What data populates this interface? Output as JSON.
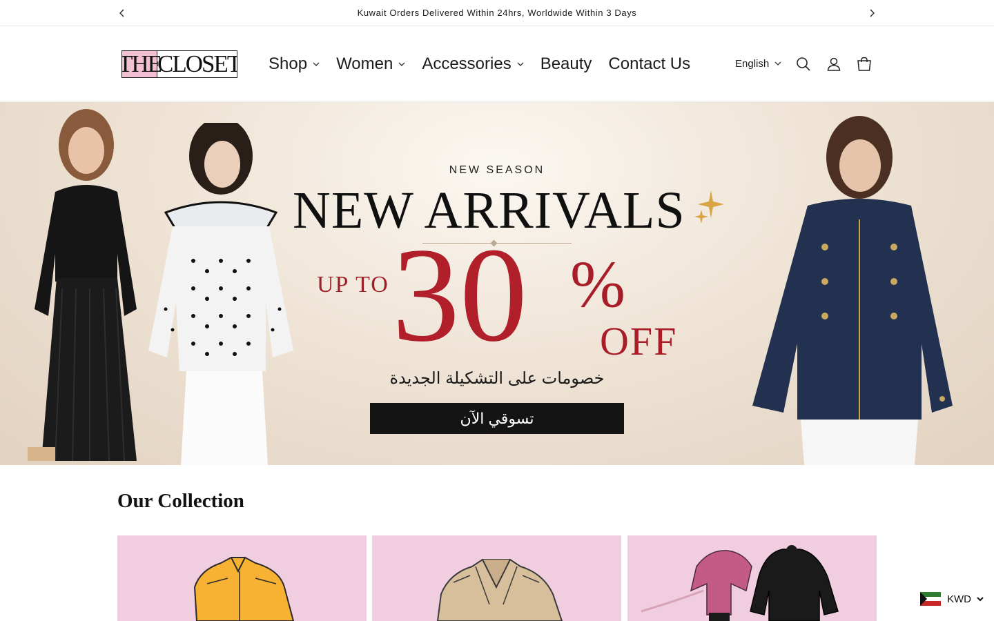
{
  "announcement": {
    "message": "Kuwait Orders Delivered Within 24hrs, Worldwide Within 3 Days",
    "prev_icon": "chevron-left-icon",
    "next_icon": "chevron-right-icon"
  },
  "header": {
    "logo": {
      "the": "THE",
      "closet": "CLOSET"
    },
    "nav": [
      {
        "label": "Shop",
        "has_dropdown": true
      },
      {
        "label": "Women",
        "has_dropdown": true
      },
      {
        "label": "Accessories",
        "has_dropdown": true
      },
      {
        "label": "Beauty",
        "has_dropdown": false
      },
      {
        "label": "Contact Us",
        "has_dropdown": false
      }
    ],
    "language": "English",
    "icons": [
      "search-icon",
      "account-icon",
      "cart-icon"
    ]
  },
  "hero": {
    "eyebrow": "NEW SEASON",
    "headline": "NEW ARRIVALS",
    "up_to": "UP TO",
    "discount_number": "30",
    "percent": "%",
    "off": "OFF",
    "arabic_subtitle": "خصومات على التشكيلة الجديدة",
    "cta": "تسوقي الآن"
  },
  "collection": {
    "title": "Our Collection",
    "cards": [
      "yellow-shirt-sketch",
      "beige-trench-sketch",
      "pink-black-outfits-sketch"
    ]
  },
  "currency": {
    "code": "KWD",
    "flag": "kuwait-flag-icon"
  },
  "colors": {
    "accent_pink": "#f3bfd3",
    "card_pink": "#f1cde0",
    "discount_red": "#b11f2a",
    "cta_black": "#141414"
  }
}
